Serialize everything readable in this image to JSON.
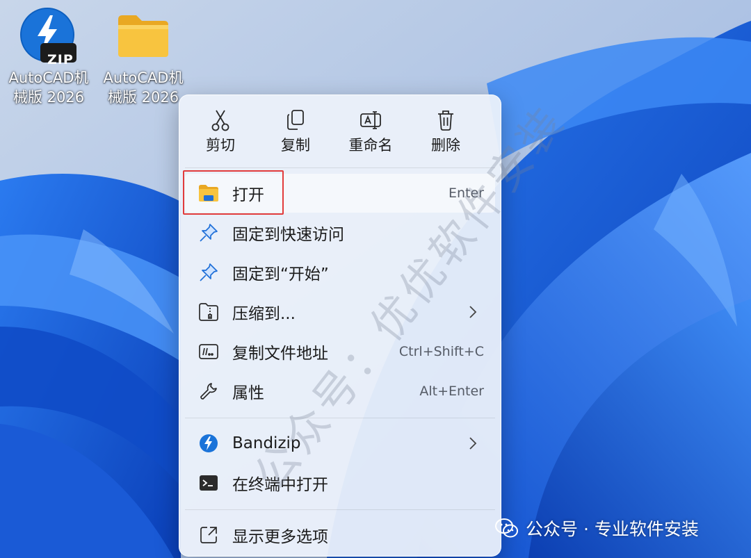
{
  "desktop": {
    "icons": [
      {
        "label": "AutoCAD机械版 2026",
        "type": "zip-archive",
        "badge": "ZIP"
      },
      {
        "label": "AutoCAD机械版 2026",
        "type": "folder"
      }
    ]
  },
  "context_menu": {
    "quick_actions": [
      {
        "label": "剪切",
        "icon": "scissors-icon"
      },
      {
        "label": "复制",
        "icon": "copy-icon"
      },
      {
        "label": "重命名",
        "icon": "rename-icon"
      },
      {
        "label": "删除",
        "icon": "trash-icon"
      }
    ],
    "items": [
      {
        "label": "打开",
        "shortcut": "Enter",
        "icon": "folder-open-icon",
        "highlighted": true
      },
      {
        "label": "固定到快速访问",
        "shortcut": "",
        "icon": "pin-icon"
      },
      {
        "label": "固定到“开始”",
        "shortcut": "",
        "icon": "pin-icon"
      },
      {
        "label": "压缩到...",
        "shortcut": "",
        "icon": "compress-icon",
        "submenu": true
      },
      {
        "label": "复制文件地址",
        "shortcut": "Ctrl+Shift+C",
        "icon": "copy-path-icon"
      },
      {
        "label": "属性",
        "shortcut": "Alt+Enter",
        "icon": "wrench-icon"
      },
      {
        "label": "Bandizip",
        "shortcut": "",
        "icon": "bandizip-icon",
        "submenu": true
      },
      {
        "label": "在终端中打开",
        "shortcut": "",
        "icon": "terminal-icon"
      },
      {
        "label": "显示更多选项",
        "shortcut": "",
        "icon": "more-options-icon"
      }
    ]
  },
  "watermarks": {
    "diagonal": "公众号：优优软件安装",
    "bottom": "公众号 · 专业软件安装"
  },
  "colors": {
    "highlight_border": "#e23b3b",
    "bandizip_blue": "#1a73d9",
    "folder_yellow": "#f8c43f"
  }
}
